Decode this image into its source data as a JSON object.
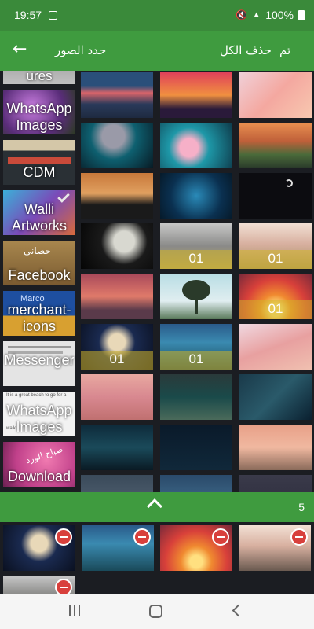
{
  "status": {
    "time": "19:57",
    "battery": "100%",
    "icons": [
      "gallery-notification-icon",
      "mute-icon",
      "signal-icon",
      "battery-icon"
    ]
  },
  "appbar": {
    "title": "حدد الصور",
    "delete_all": "حذف الكل",
    "done": "تم",
    "back_icon": "arrow-back-icon"
  },
  "albums": [
    {
      "label": "ures"
    },
    {
      "label": "WhatsApp Images"
    },
    {
      "label": "CDM"
    },
    {
      "label": "Walli Artworks"
    },
    {
      "label": "Facebook"
    },
    {
      "label": "merchant-icons"
    },
    {
      "label": "Messenger"
    },
    {
      "label": "WhatsApp Images"
    },
    {
      "label": "Download"
    }
  ],
  "album_overlay_texts": {
    "arabic_label": "حصاني",
    "arabic_label_2": "صباح الورد",
    "book_title": "Marco",
    "doc_line1": "It is a great beach to go for a",
    "doc_line2": "walk"
  },
  "photos": [
    {
      "badge": ""
    },
    {
      "badge": ""
    },
    {
      "badge": ""
    },
    {
      "badge": ""
    },
    {
      "badge": ""
    },
    {
      "badge": ""
    },
    {
      "badge": ""
    },
    {
      "badge": ""
    },
    {
      "badge": ""
    },
    {
      "badge": ""
    },
    {
      "badge": "01"
    },
    {
      "badge": "01"
    },
    {
      "badge": ""
    },
    {
      "badge": ""
    },
    {
      "badge": "01"
    },
    {
      "badge": "01"
    },
    {
      "badge": "01"
    },
    {
      "badge": ""
    },
    {
      "badge": ""
    },
    {
      "badge": ""
    },
    {
      "badge": ""
    },
    {
      "badge": ""
    },
    {
      "badge": ""
    },
    {
      "badge": ""
    },
    {
      "badge": ""
    },
    {
      "badge": ""
    },
    {
      "badge": ""
    }
  ],
  "selection": {
    "count": "5",
    "expand_icon": "chevron-up-icon",
    "remove_icon": "remove-circle-icon"
  },
  "navbar": {
    "icons": [
      "recents-icon",
      "home-icon",
      "back-icon"
    ]
  },
  "colors": {
    "accent": "#3f9b3f",
    "status": "#3a8a3a",
    "remove": "#d8403c"
  }
}
